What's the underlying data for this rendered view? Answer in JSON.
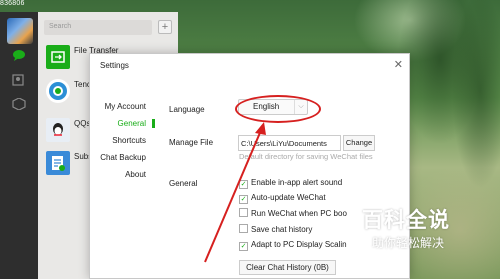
{
  "top_number": "836806",
  "wechat": {
    "search_placeholder": "Search",
    "plus": "+",
    "chats": [
      {
        "name": "File Transfer",
        "color": "#1aad19"
      },
      {
        "name": "Tenc",
        "color": "#2c8fd6"
      },
      {
        "name": "QQs",
        "color": "#e8eef5"
      },
      {
        "name": "Subs",
        "color": "#3a8ad8"
      }
    ]
  },
  "settings": {
    "title": "Settings",
    "close": "✕",
    "nav": [
      "My Account",
      "General",
      "Shortcuts",
      "Chat Backup",
      "About"
    ],
    "active_nav": "General",
    "language_label": "Language",
    "language_value": "English",
    "manage_file_label": "Manage File",
    "file_path": "C:\\Users\\LiYu\\Documents",
    "change_button": "Change",
    "file_hint": "Default directory for saving WeChat files",
    "general_label": "General",
    "options": [
      {
        "label": "Enable in-app alert sound",
        "checked": true
      },
      {
        "label": "Auto-update WeChat",
        "checked": true
      },
      {
        "label": "Run WeChat when PC boo",
        "checked": false
      },
      {
        "label": "Save chat history",
        "checked": false
      },
      {
        "label": "Adapt to PC Display Scalin",
        "checked": true
      }
    ],
    "clear_button": "Clear Chat History  (0B)"
  },
  "annotation_color": "#d6201f",
  "watermark": {
    "title": "百科全说",
    "subtitle": "助你轻松解决"
  }
}
